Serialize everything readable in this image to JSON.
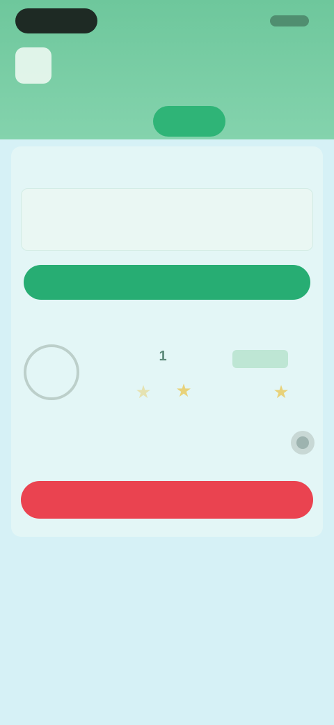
{
  "header": {
    "app_icon": "app-logo-icon",
    "title": "",
    "colors": {
      "header_bg": "#7dcfa8",
      "accent": "#27ad73"
    }
  },
  "tabs": [
    {
      "label": "",
      "active": false
    },
    {
      "label": "",
      "active": false
    },
    {
      "label": "",
      "active": true
    },
    {
      "label": "",
      "active": false
    }
  ],
  "main": {
    "section_label": "",
    "input": {
      "value": "",
      "placeholder": ""
    },
    "primary_button_label": "",
    "status_label": "",
    "dial_value": "",
    "stat_number": "1",
    "stat_value": "",
    "stars": [
      {
        "icon": "star-icon"
      },
      {
        "icon": "star-icon"
      },
      {
        "icon": "star-icon"
      }
    ],
    "row_label": "",
    "toggle_icon": "toggle-icon",
    "danger_button_label": "",
    "colors": {
      "primary": "#27ad73",
      "danger": "#ea4350",
      "background": "#d6f1f6"
    }
  }
}
